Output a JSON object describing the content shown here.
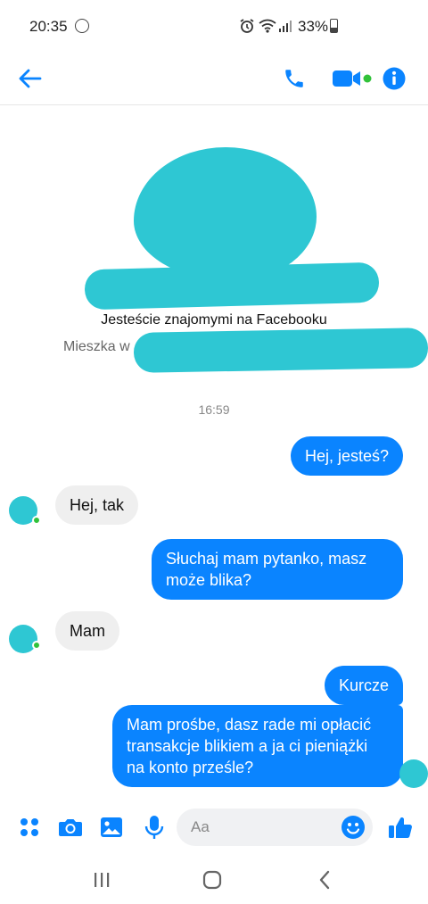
{
  "status_bar": {
    "time": "20:35",
    "battery": "33%"
  },
  "header": {
    "back_icon": "arrow-left-icon",
    "call_icon": "phone-icon",
    "video_icon": "video-camera-icon",
    "info_icon": "info-icon"
  },
  "profile": {
    "friends_text": "Jesteście znajomymi na Facebooku",
    "lives_in_prefix": "Mieszka w"
  },
  "conversation": {
    "timestamp": "16:59",
    "messages": [
      {
        "direction": "out",
        "text": "Hej, jesteś?"
      },
      {
        "direction": "in",
        "text": "Hej, tak"
      },
      {
        "direction": "out",
        "text": "Słuchaj mam pytanko, masz może blika?"
      },
      {
        "direction": "in",
        "text": "Mam"
      },
      {
        "direction": "out",
        "text": "Kurcze"
      },
      {
        "direction": "out",
        "text": "Mam prośbe, dasz rade mi opłacić transakcje blikiem a ja ci pieniążki na konto prześle?"
      }
    ]
  },
  "composer": {
    "placeholder": "Aa",
    "icons": [
      "apps-icon",
      "camera-icon",
      "gallery-icon",
      "microphone-icon",
      "emoji-icon",
      "thumbs-up-icon"
    ]
  },
  "colors": {
    "accent": "#0a84ff",
    "incoming_bubble": "#efefef",
    "redaction": "#2ec7d3",
    "online": "#31c23a"
  }
}
